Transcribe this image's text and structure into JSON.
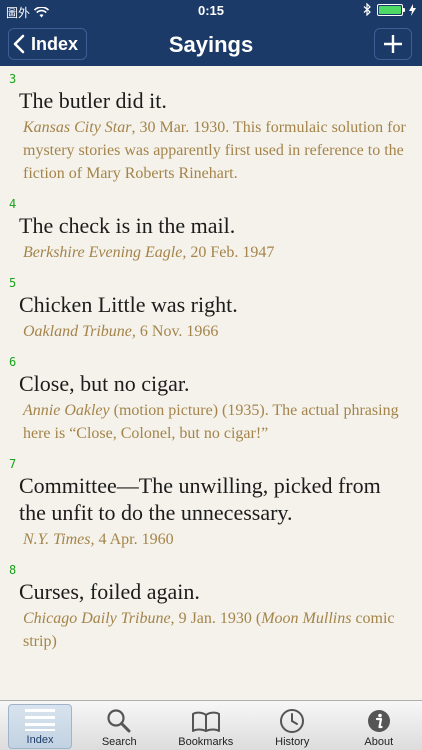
{
  "status": {
    "carrier": "圖外",
    "time": "0:15"
  },
  "nav": {
    "back_label": "Index",
    "title": "Sayings"
  },
  "entries": [
    {
      "num": "3",
      "title": "The butler did it.",
      "source_italic": "Kansas City Star",
      "source_rest": ", 30 Mar. 1930. This formulaic solution for mystery stories was apparently first used in reference to the fiction of Mary Roberts Rinehart."
    },
    {
      "num": "4",
      "title": "The check is in the mail.",
      "source_italic": "Berkshire Evening Eagle,",
      "source_rest": " 20 Feb. 1947"
    },
    {
      "num": "5",
      "title": "Chicken Little was right.",
      "source_italic": "Oakland Tribune,",
      "source_rest": " 6 Nov. 1966"
    },
    {
      "num": "6",
      "title": "Close, but no cigar.",
      "source_italic": "Annie Oakley",
      "source_rest": " (motion picture) (1935). The actual phrasing here is “Close, Colonel, but no cigar!”"
    },
    {
      "num": "7",
      "title": "Committee—The unwilling, picked from the unfit to do the unnecessary.",
      "source_italic": "N.Y. Times,",
      "source_rest": " 4 Apr. 1960"
    },
    {
      "num": "8",
      "title": "Curses, foiled again.",
      "source_italic": "Chicago Daily Tribune,",
      "source_rest": " 9 Jan. 1930 (",
      "source_italic2": "Moon Mullins",
      "source_rest2": " comic strip)"
    }
  ],
  "tabs": [
    {
      "label": "Index",
      "icon": "list-icon"
    },
    {
      "label": "Search",
      "icon": "search-icon"
    },
    {
      "label": "Bookmarks",
      "icon": "book-icon"
    },
    {
      "label": "History",
      "icon": "clock-icon"
    },
    {
      "label": "About",
      "icon": "info-icon"
    }
  ],
  "colors": {
    "nav": "#1c3a68",
    "number": "#1aa31a",
    "source": "#a4844b",
    "battery": "#4cd964"
  }
}
